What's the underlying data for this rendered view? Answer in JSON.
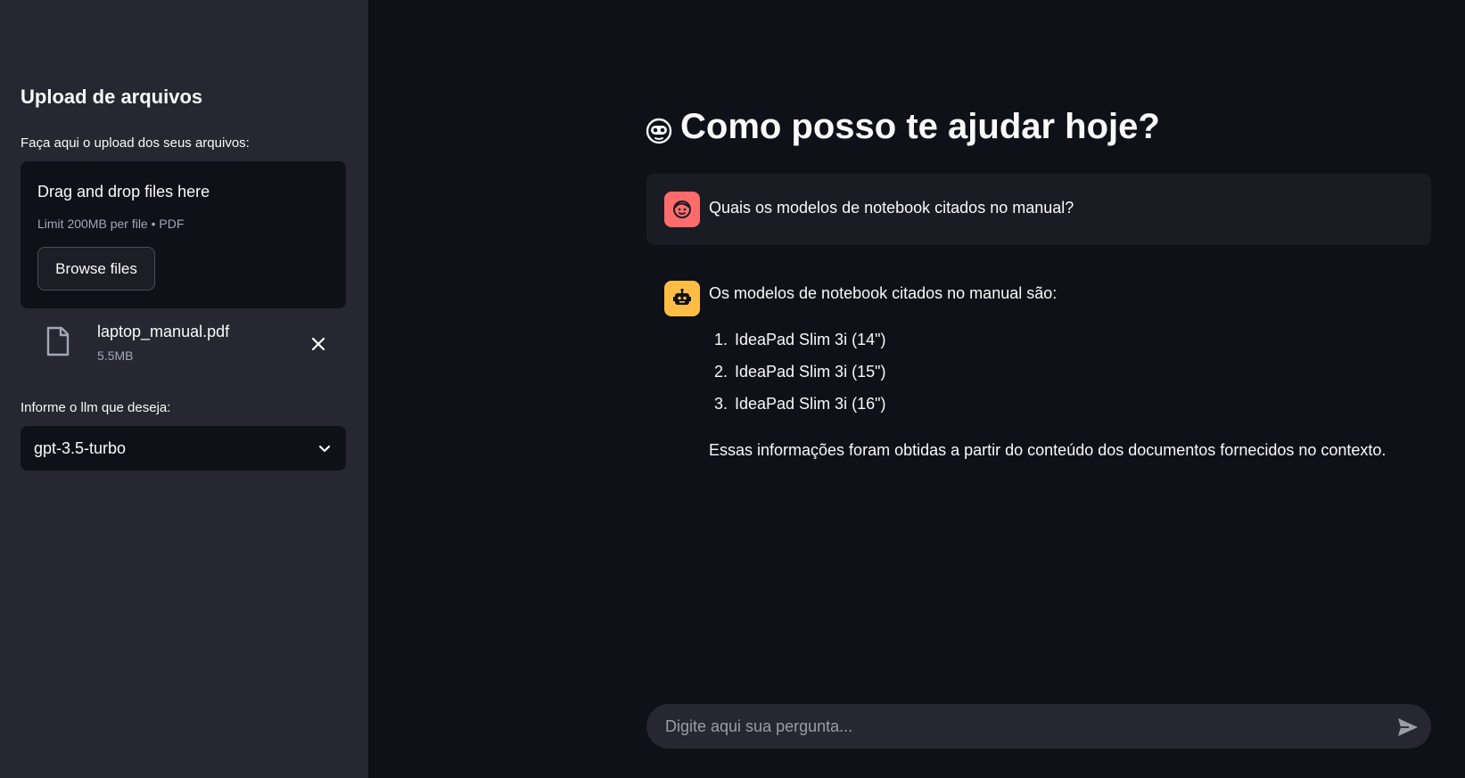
{
  "sidebar": {
    "title": "Upload de arquivos",
    "upload_label": "Faça aqui o upload dos seus arquivos:",
    "dropzone": {
      "title": "Drag and drop files here",
      "limit": "Limit 200MB per file • PDF",
      "browse_label": "Browse files"
    },
    "file": {
      "name": "laptop_manual.pdf",
      "size": "5.5MB"
    },
    "llm_label": "Informe o llm que deseja:",
    "llm_selected": "gpt-3.5-turbo"
  },
  "main": {
    "title": "Como posso te ajudar hoje?",
    "messages": {
      "user": {
        "text": "Quais os modelos de notebook citados no manual?"
      },
      "bot": {
        "intro": "Os modelos de notebook citados no manual são:",
        "items": [
          {
            "num": "1.",
            "text": "IdeaPad Slim 3i (14\")"
          },
          {
            "num": "2.",
            "text": "IdeaPad Slim 3i (15\")"
          },
          {
            "num": "3.",
            "text": "IdeaPad Slim 3i (16\")"
          }
        ],
        "outro": "Essas informações foram obtidas a partir do conteúdo dos documentos fornecidos no contexto."
      }
    },
    "input": {
      "placeholder": "Digite aqui sua pergunta...",
      "value": ""
    }
  },
  "colors": {
    "main_bg": "#0e1117",
    "sidebar_bg": "#262730",
    "user_avatar": "#ff6b6b",
    "bot_avatar": "#ffbd45"
  },
  "icons": {
    "title": "robot-face-icon",
    "file": "file-icon",
    "remove": "close-icon",
    "select": "chevron-down-icon",
    "user_avatar": "user-face-icon",
    "bot_avatar": "robot-icon",
    "send": "send-icon"
  }
}
